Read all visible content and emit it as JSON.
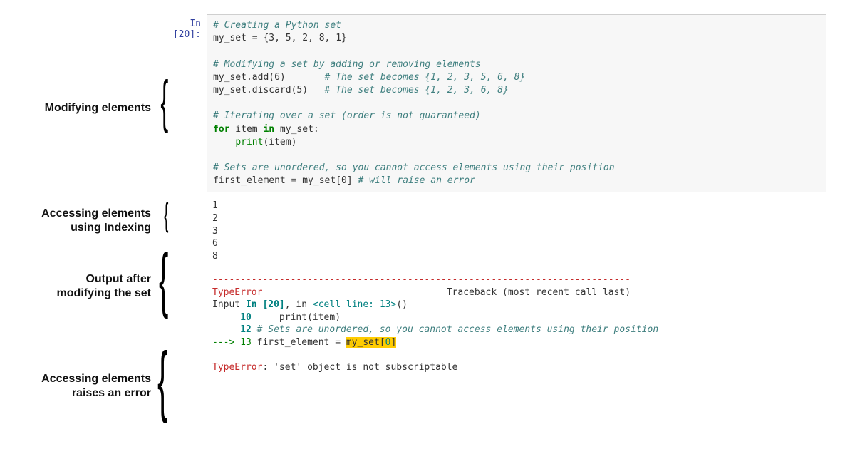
{
  "prompt": "In [20]:",
  "code": {
    "l1_comment": "# Creating a Python set",
    "l2_var": "my_set",
    "l2_eq": " = ",
    "l2_lit": "{3, 5, 2, 8, 1}",
    "l4_comment": "# Modifying a set by adding or removing elements",
    "l5": "my_set.add(6)",
    "l5_c": "# The set becomes {1, 2, 3, 5, 6, 8}",
    "l6": "my_set.discard(5)",
    "l6_c": "# The set becomes {1, 2, 3, 6, 8}",
    "l8_comment": "# Iterating over a set (order is not guaranteed)",
    "l9_for": "for",
    "l9_rest": " item ",
    "l9_in": "in",
    "l9_tail": " my_set:",
    "l10_indent": "    ",
    "l10_print": "print",
    "l10_args": "(item)",
    "l12_comment": "# Sets are unordered, so you cannot access elements using their position",
    "l13_a": "first_element",
    "l13_eq": " = ",
    "l13_b": "my_set[0]",
    "l13_c": " # will raise an error"
  },
  "output_lines": [
    "1",
    "2",
    "3",
    "6",
    "8"
  ],
  "error": {
    "dash": "---------------------------------------------------------------------------",
    "name": "TypeError",
    "trace": "Traceback (most recent call last)",
    "input_a": "Input ",
    "input_b": "In [20]",
    "input_c": ", in ",
    "input_d": "<cell line: 13>",
    "input_e": "()",
    "l10n": "     10",
    "l10_body": "     print(item)",
    "l12n": "     12",
    "l12_body": " # Sets are unordered, so you cannot access elements using their position",
    "arrow": "---> 13",
    "l13_body_a": " first_element = ",
    "l13_hl_a": "my_set[",
    "l13_hl_n": "0",
    "l13_hl_b": "]",
    "final_a": "TypeError",
    "final_b": ": 'set' object is not subscriptable"
  },
  "labels": {
    "modify": "Modifying elements",
    "index_l1": "Accessing elements",
    "index_l2": "using Indexing",
    "out_l1": "Output after",
    "out_l2": "modifying the set",
    "err_l1": "Accessing elements",
    "err_l2": "raises an error"
  }
}
